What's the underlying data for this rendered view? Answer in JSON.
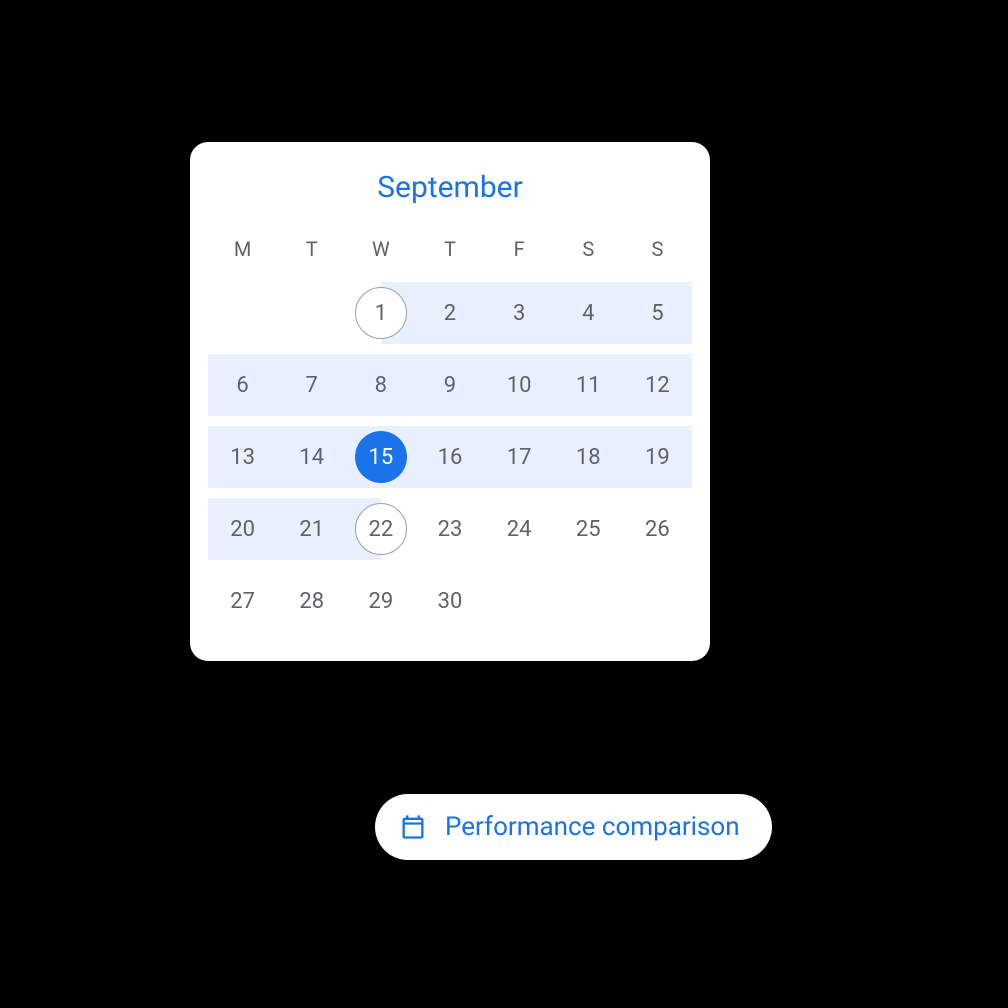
{
  "calendar": {
    "month": "September",
    "dayHeaders": [
      "M",
      "T",
      "W",
      "T",
      "F",
      "S",
      "S"
    ],
    "weeks": [
      [
        {
          "num": "",
          "empty": true
        },
        {
          "num": "",
          "empty": true
        },
        {
          "num": "1",
          "outlined": true
        },
        {
          "num": "2"
        },
        {
          "num": "3"
        },
        {
          "num": "4"
        },
        {
          "num": "5"
        }
      ],
      [
        {
          "num": "6"
        },
        {
          "num": "7"
        },
        {
          "num": "8"
        },
        {
          "num": "9"
        },
        {
          "num": "10"
        },
        {
          "num": "11"
        },
        {
          "num": "12"
        }
      ],
      [
        {
          "num": "13"
        },
        {
          "num": "14"
        },
        {
          "num": "15",
          "selected": true
        },
        {
          "num": "16"
        },
        {
          "num": "17"
        },
        {
          "num": "18"
        },
        {
          "num": "19"
        }
      ],
      [
        {
          "num": "20"
        },
        {
          "num": "21"
        },
        {
          "num": "22",
          "outlined": true
        },
        {
          "num": "23"
        },
        {
          "num": "24"
        },
        {
          "num": "25"
        },
        {
          "num": "26"
        }
      ],
      [
        {
          "num": "27"
        },
        {
          "num": "28"
        },
        {
          "num": "29"
        },
        {
          "num": "30"
        },
        {
          "num": "",
          "empty": true
        },
        {
          "num": "",
          "empty": true
        },
        {
          "num": "",
          "empty": true
        }
      ]
    ]
  },
  "chip": {
    "label": "Performance comparison"
  }
}
